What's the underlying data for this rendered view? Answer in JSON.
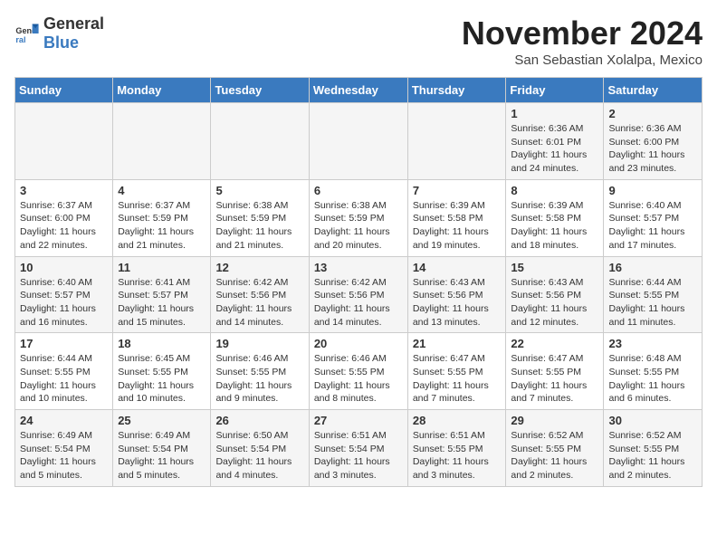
{
  "header": {
    "logo_general": "General",
    "logo_blue": "Blue",
    "month_title": "November 2024",
    "location": "San Sebastian Xolalpa, Mexico"
  },
  "weekdays": [
    "Sunday",
    "Monday",
    "Tuesday",
    "Wednesday",
    "Thursday",
    "Friday",
    "Saturday"
  ],
  "weeks": [
    [
      {
        "day": "",
        "info": ""
      },
      {
        "day": "",
        "info": ""
      },
      {
        "day": "",
        "info": ""
      },
      {
        "day": "",
        "info": ""
      },
      {
        "day": "",
        "info": ""
      },
      {
        "day": "1",
        "info": "Sunrise: 6:36 AM\nSunset: 6:01 PM\nDaylight: 11 hours and 24 minutes."
      },
      {
        "day": "2",
        "info": "Sunrise: 6:36 AM\nSunset: 6:00 PM\nDaylight: 11 hours and 23 minutes."
      }
    ],
    [
      {
        "day": "3",
        "info": "Sunrise: 6:37 AM\nSunset: 6:00 PM\nDaylight: 11 hours and 22 minutes."
      },
      {
        "day": "4",
        "info": "Sunrise: 6:37 AM\nSunset: 5:59 PM\nDaylight: 11 hours and 21 minutes."
      },
      {
        "day": "5",
        "info": "Sunrise: 6:38 AM\nSunset: 5:59 PM\nDaylight: 11 hours and 21 minutes."
      },
      {
        "day": "6",
        "info": "Sunrise: 6:38 AM\nSunset: 5:59 PM\nDaylight: 11 hours and 20 minutes."
      },
      {
        "day": "7",
        "info": "Sunrise: 6:39 AM\nSunset: 5:58 PM\nDaylight: 11 hours and 19 minutes."
      },
      {
        "day": "8",
        "info": "Sunrise: 6:39 AM\nSunset: 5:58 PM\nDaylight: 11 hours and 18 minutes."
      },
      {
        "day": "9",
        "info": "Sunrise: 6:40 AM\nSunset: 5:57 PM\nDaylight: 11 hours and 17 minutes."
      }
    ],
    [
      {
        "day": "10",
        "info": "Sunrise: 6:40 AM\nSunset: 5:57 PM\nDaylight: 11 hours and 16 minutes."
      },
      {
        "day": "11",
        "info": "Sunrise: 6:41 AM\nSunset: 5:57 PM\nDaylight: 11 hours and 15 minutes."
      },
      {
        "day": "12",
        "info": "Sunrise: 6:42 AM\nSunset: 5:56 PM\nDaylight: 11 hours and 14 minutes."
      },
      {
        "day": "13",
        "info": "Sunrise: 6:42 AM\nSunset: 5:56 PM\nDaylight: 11 hours and 14 minutes."
      },
      {
        "day": "14",
        "info": "Sunrise: 6:43 AM\nSunset: 5:56 PM\nDaylight: 11 hours and 13 minutes."
      },
      {
        "day": "15",
        "info": "Sunrise: 6:43 AM\nSunset: 5:56 PM\nDaylight: 11 hours and 12 minutes."
      },
      {
        "day": "16",
        "info": "Sunrise: 6:44 AM\nSunset: 5:55 PM\nDaylight: 11 hours and 11 minutes."
      }
    ],
    [
      {
        "day": "17",
        "info": "Sunrise: 6:44 AM\nSunset: 5:55 PM\nDaylight: 11 hours and 10 minutes."
      },
      {
        "day": "18",
        "info": "Sunrise: 6:45 AM\nSunset: 5:55 PM\nDaylight: 11 hours and 10 minutes."
      },
      {
        "day": "19",
        "info": "Sunrise: 6:46 AM\nSunset: 5:55 PM\nDaylight: 11 hours and 9 minutes."
      },
      {
        "day": "20",
        "info": "Sunrise: 6:46 AM\nSunset: 5:55 PM\nDaylight: 11 hours and 8 minutes."
      },
      {
        "day": "21",
        "info": "Sunrise: 6:47 AM\nSunset: 5:55 PM\nDaylight: 11 hours and 7 minutes."
      },
      {
        "day": "22",
        "info": "Sunrise: 6:47 AM\nSunset: 5:55 PM\nDaylight: 11 hours and 7 minutes."
      },
      {
        "day": "23",
        "info": "Sunrise: 6:48 AM\nSunset: 5:55 PM\nDaylight: 11 hours and 6 minutes."
      }
    ],
    [
      {
        "day": "24",
        "info": "Sunrise: 6:49 AM\nSunset: 5:54 PM\nDaylight: 11 hours and 5 minutes."
      },
      {
        "day": "25",
        "info": "Sunrise: 6:49 AM\nSunset: 5:54 PM\nDaylight: 11 hours and 5 minutes."
      },
      {
        "day": "26",
        "info": "Sunrise: 6:50 AM\nSunset: 5:54 PM\nDaylight: 11 hours and 4 minutes."
      },
      {
        "day": "27",
        "info": "Sunrise: 6:51 AM\nSunset: 5:54 PM\nDaylight: 11 hours and 3 minutes."
      },
      {
        "day": "28",
        "info": "Sunrise: 6:51 AM\nSunset: 5:55 PM\nDaylight: 11 hours and 3 minutes."
      },
      {
        "day": "29",
        "info": "Sunrise: 6:52 AM\nSunset: 5:55 PM\nDaylight: 11 hours and 2 minutes."
      },
      {
        "day": "30",
        "info": "Sunrise: 6:52 AM\nSunset: 5:55 PM\nDaylight: 11 hours and 2 minutes."
      }
    ]
  ]
}
